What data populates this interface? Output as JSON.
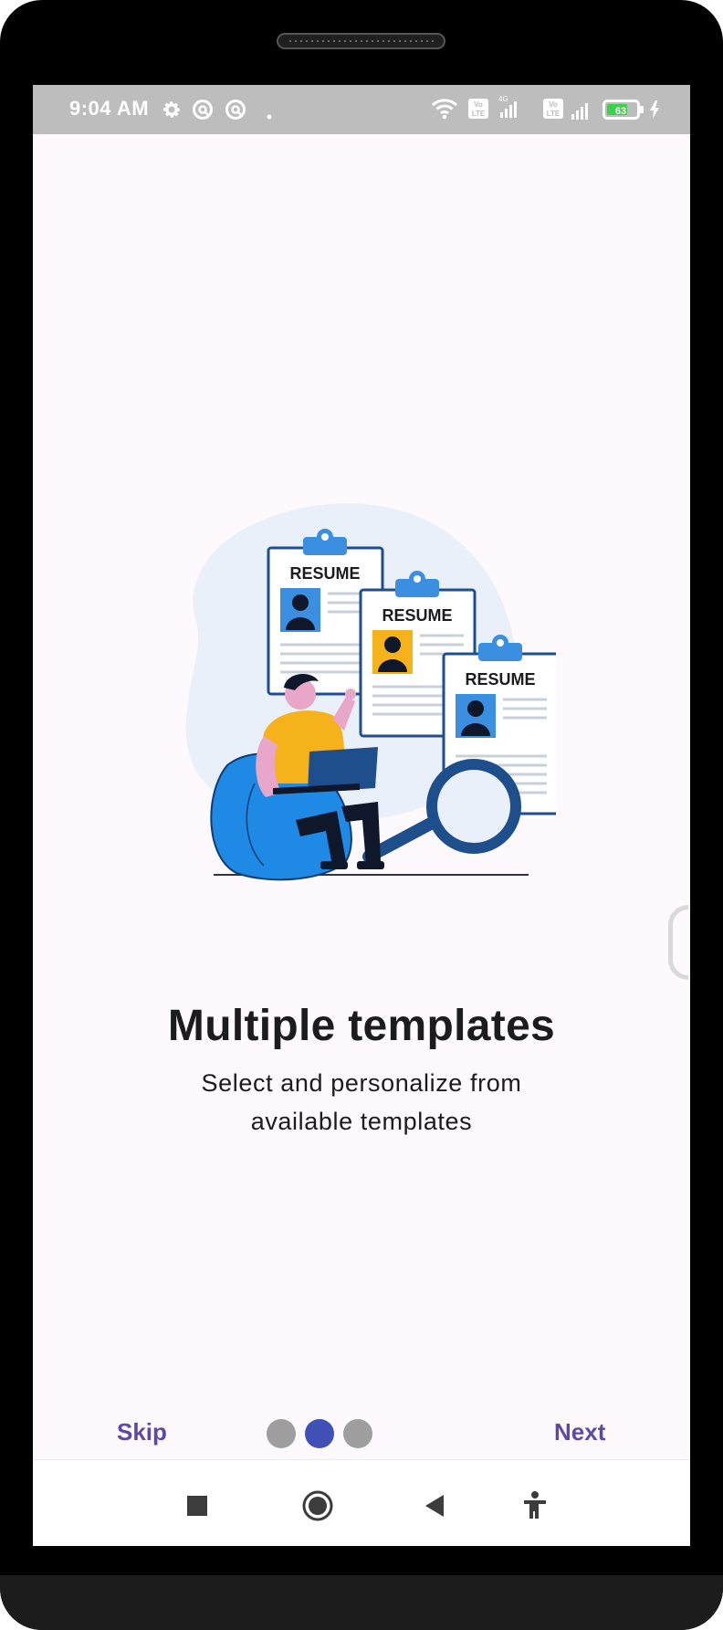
{
  "status_bar": {
    "time": "9:04 AM",
    "battery_level": "63",
    "network_label": "4G",
    "volte_label": "Vo LTE",
    "icons": [
      "gear-icon",
      "vpn-icon",
      "vpn-icon",
      "dot-icon",
      "wifi-icon",
      "volte-icon",
      "signal-icon",
      "volte-icon",
      "signal-icon",
      "battery-icon",
      "charging-icon"
    ]
  },
  "illustration": {
    "cards": [
      {
        "label": "RESUME",
        "photo_color": "#3b8fe0"
      },
      {
        "label": "RESUME",
        "photo_color": "#f6b21b"
      },
      {
        "label": "RESUME",
        "photo_color": "#3b8fe0"
      }
    ]
  },
  "onboarding": {
    "title": "Multiple templates",
    "subtitle": "Select and personalize from available templates",
    "skip_label": "Skip",
    "next_label": "Next",
    "page_count": 3,
    "active_page": 2
  },
  "colors": {
    "accent": "#5a4aa3",
    "active_dot": "#3f51b5",
    "inactive_dot": "#9e9e9e",
    "background": "#fdf9fd",
    "status_bar": "#bdbdbd"
  },
  "nav_bar": {
    "buttons": [
      "recents-icon",
      "home-icon",
      "back-icon",
      "accessibility-icon"
    ]
  }
}
